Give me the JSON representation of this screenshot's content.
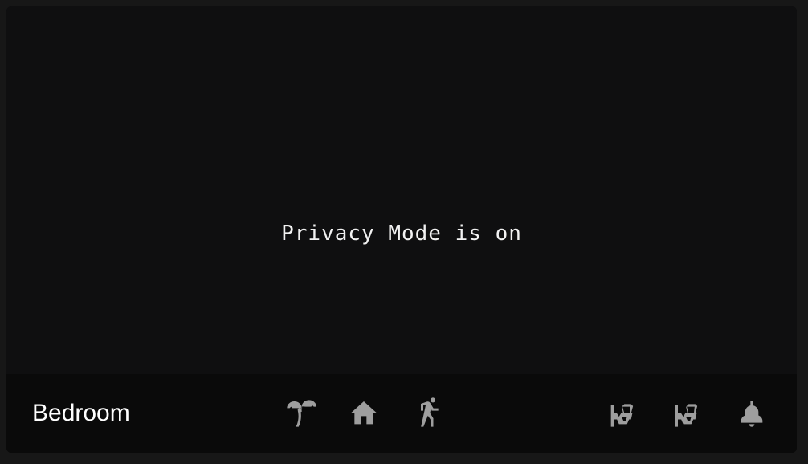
{
  "camera": {
    "status_text": "Privacy Mode is on"
  },
  "footer": {
    "room_name": "Bedroom",
    "left_icons": [
      {
        "name": "palm-tree-icon"
      },
      {
        "name": "home-icon"
      },
      {
        "name": "walk-icon"
      }
    ],
    "right_icons": [
      {
        "name": "outdoor-lamp-icon"
      },
      {
        "name": "outdoor-lamp-icon"
      },
      {
        "name": "ceiling-light-icon"
      }
    ],
    "icon_color": "#9e9e9e"
  },
  "colors": {
    "background": "#171717",
    "card": "#0f0f0f",
    "footer": "#0a0a0a",
    "text": "#ffffff"
  }
}
